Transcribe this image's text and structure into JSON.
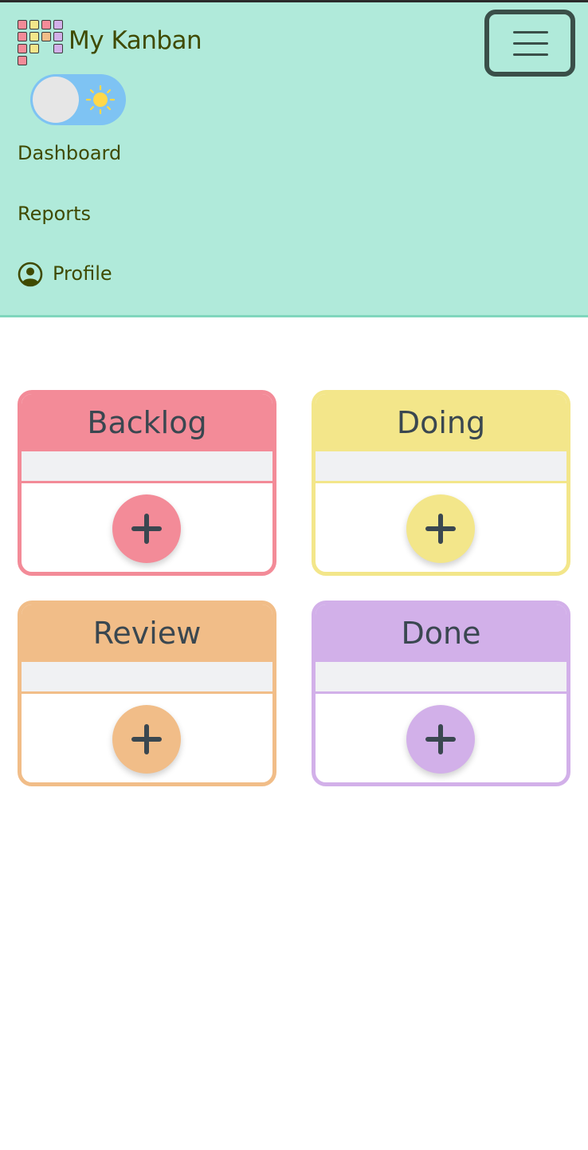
{
  "header": {
    "brand": "My Kanban",
    "menu_icon": "hamburger-menu-icon",
    "theme_toggle": {
      "state": "light",
      "icon": "sun-icon"
    }
  },
  "nav": {
    "items": [
      {
        "label": "Dashboard"
      },
      {
        "label": "Reports"
      },
      {
        "label": "Profile",
        "icon": "user-circle-icon"
      }
    ]
  },
  "board": {
    "columns": [
      {
        "title": "Backlog",
        "color": "#f38b98",
        "add_icon": "plus-icon"
      },
      {
        "title": "Doing",
        "color": "#f3e68a",
        "add_icon": "plus-icon"
      },
      {
        "title": "Review",
        "color": "#f1bd88",
        "add_icon": "plus-icon"
      },
      {
        "title": "Done",
        "color": "#d2b0e9",
        "add_icon": "plus-icon"
      }
    ]
  },
  "colors": {
    "navbar_bg": "#b0eada",
    "nav_text": "#3f4a00",
    "toggle_bg": "#7ec3f3",
    "sun": "#ffd84a",
    "title_text": "#3a4750"
  }
}
